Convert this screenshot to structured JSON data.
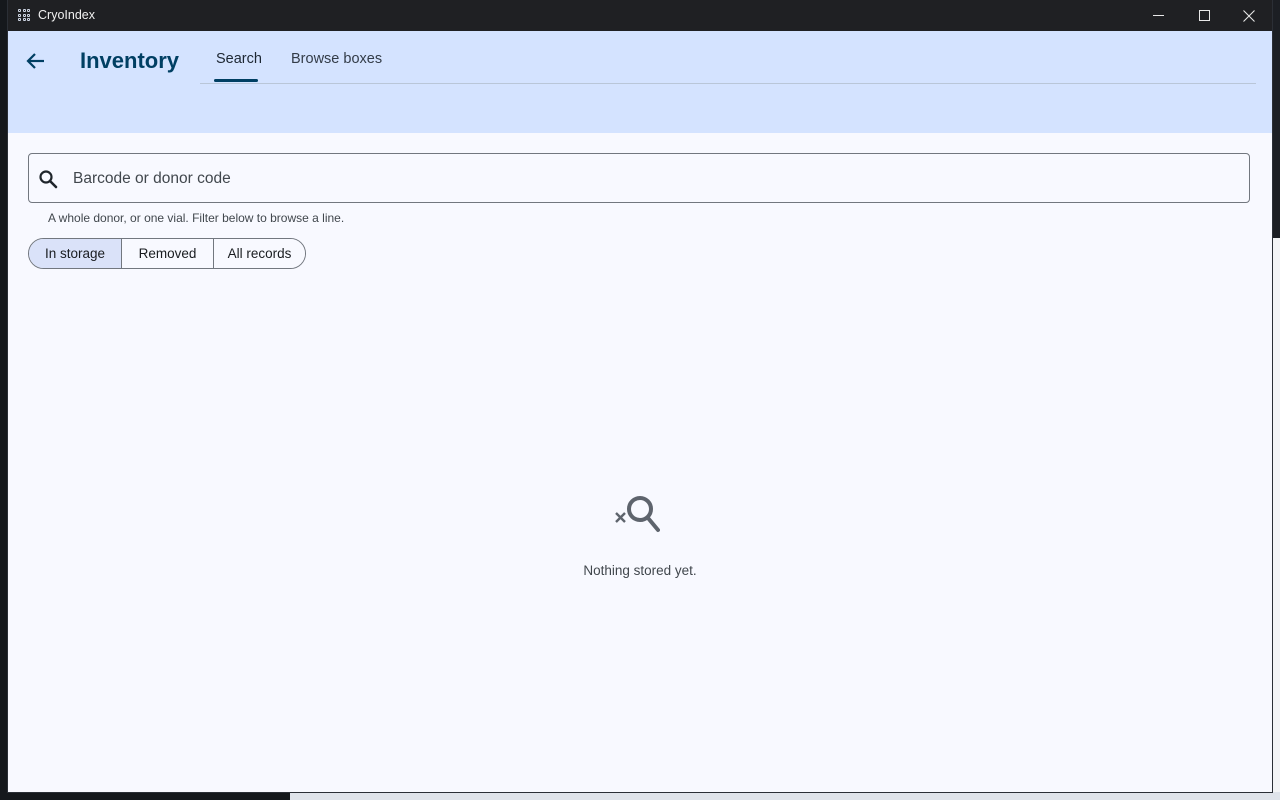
{
  "window": {
    "title": "CryoIndex"
  },
  "header": {
    "title": "Inventory",
    "tabs": [
      {
        "label": "Search",
        "selected": true
      },
      {
        "label": "Browse boxes",
        "selected": false
      }
    ]
  },
  "search": {
    "placeholder": "Barcode or donor code",
    "value": "",
    "helper": "A whole donor, or one vial. Filter below to browse a line."
  },
  "filters": {
    "options": [
      "In storage",
      "Removed",
      "All records"
    ],
    "selected": "In storage"
  },
  "empty_state": {
    "message": "Nothing stored yet.",
    "icon": "search-off-icon"
  },
  "colors": {
    "header_bg": "#d4e3ff",
    "accent": "#003f63",
    "selected_segment": "#dae2f9",
    "surface": "#f8f9ff"
  }
}
